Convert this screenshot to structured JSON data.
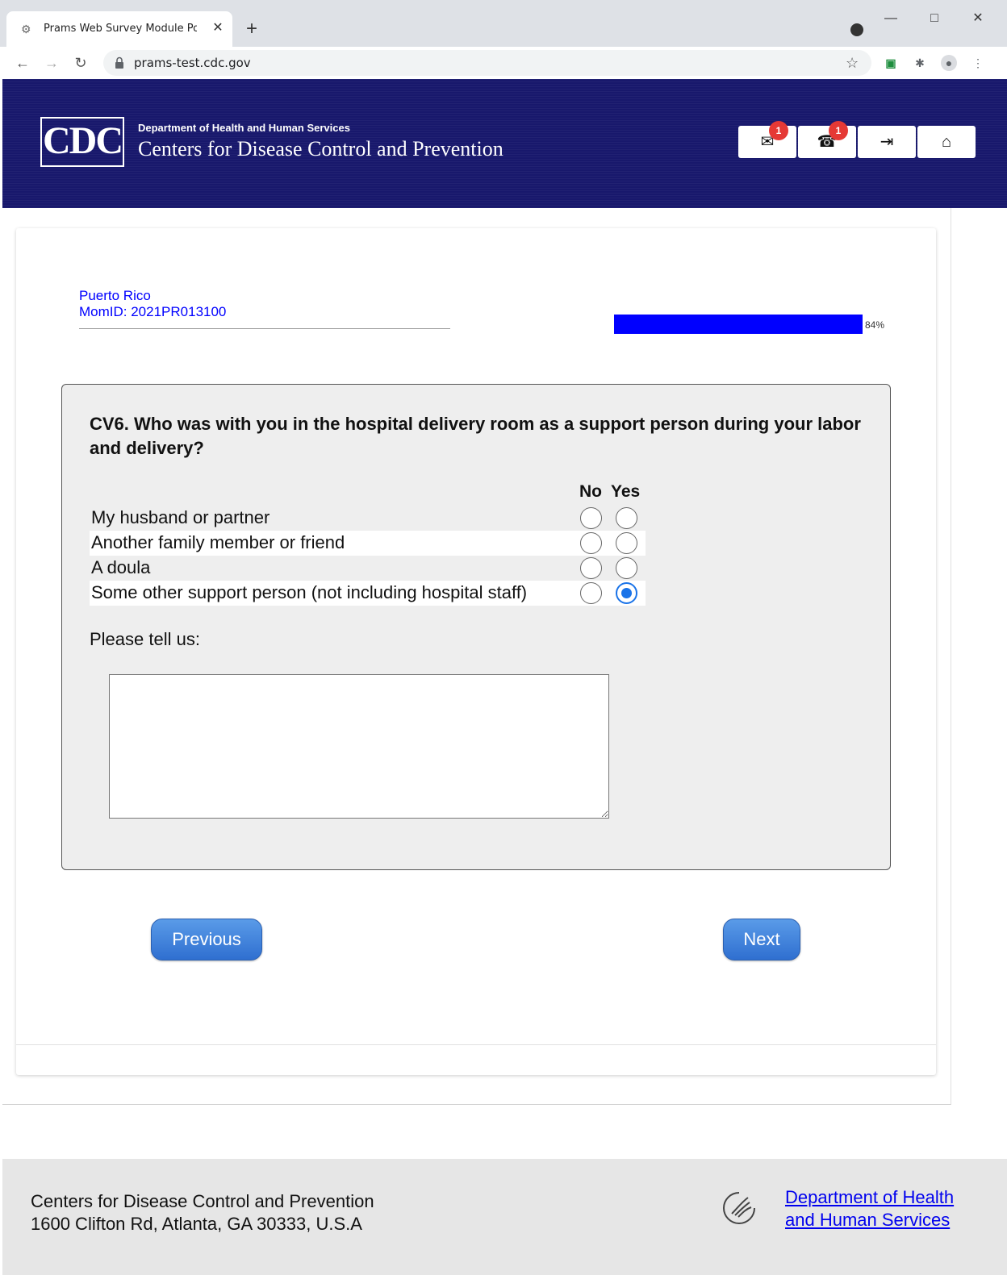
{
  "browser": {
    "tab_title": "Prams Web Survey Module Porta",
    "url": "prams-test.cdc.gov"
  },
  "header": {
    "dept": "Department of Health and Human Services",
    "agency": "Centers for Disease Control and Prevention",
    "logo_text": "CDC",
    "mail_badge": "1",
    "phone_badge": "1"
  },
  "respondent": {
    "state": "Puerto Rico",
    "mom_id": "MomID: 2021PR013100"
  },
  "progress": {
    "percent": 84,
    "label": "84%"
  },
  "question": {
    "text": "CV6. Who was with you in the hospital delivery room as a support person during your labor and delivery?",
    "col_no": "No",
    "col_yes": "Yes",
    "options": [
      {
        "label": "My husband or partner",
        "answer": null
      },
      {
        "label": "Another family member or friend",
        "answer": null
      },
      {
        "label": "A doula",
        "answer": null
      },
      {
        "label": "Some other support person (not including hospital staff)",
        "answer": "Yes"
      }
    ],
    "tell_label": "Please tell us:",
    "tell_value": ""
  },
  "nav": {
    "previous": "Previous",
    "next": "Next"
  },
  "footer": {
    "org": "Centers for Disease Control and Prevention",
    "address": "1600 Clifton Rd, Atlanta, GA 30333, U.S.A",
    "link_line1": "Department of Health",
    "link_line2": "and Human Services"
  },
  "colors": {
    "header_bg": "#18186c",
    "link": "#0000ee",
    "progress": "#0000ff",
    "button": "#2f6fd0"
  }
}
